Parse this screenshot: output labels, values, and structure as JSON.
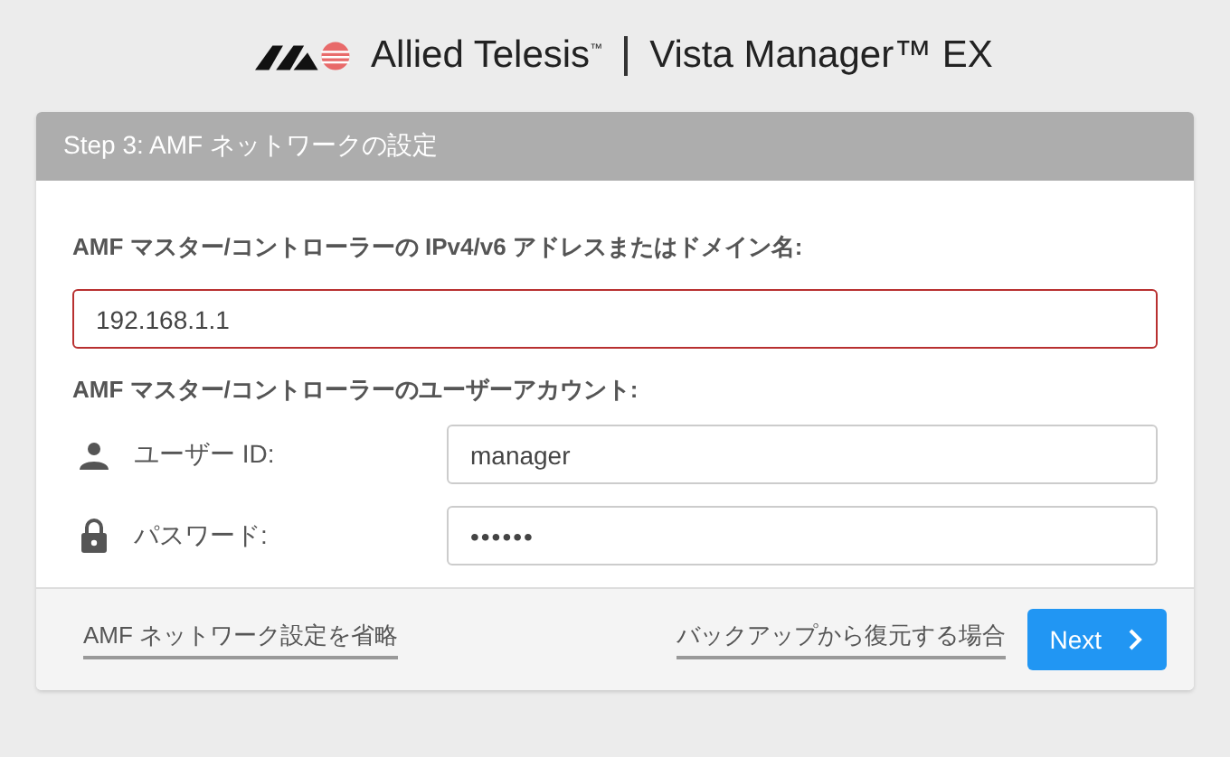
{
  "header": {
    "brand": "Allied Telesis$^{™}$",
    "product": "Vista Manager™ EX"
  },
  "panel": {
    "title": "Step 3: AMF ネットワークの設定"
  },
  "address": {
    "label": "AMF マスター/コントローラーの IPv4/v6 アドレスまたはドメイン名:",
    "value": "192.168.1.1",
    "invalid": true
  },
  "account": {
    "label": "AMF マスター/コントローラーのユーザーアカウント:",
    "fields": [
      {
        "kind": "user",
        "label": "ユーザー ID:",
        "value": "manager"
      },
      {
        "kind": "password",
        "label": "パスワード:",
        "value": "••••••"
      }
    ]
  },
  "footer": {
    "skip_link": "AMF ネットワーク設定を省略",
    "restore_link": "バックアップから復元する場合",
    "next_button": "Next"
  }
}
